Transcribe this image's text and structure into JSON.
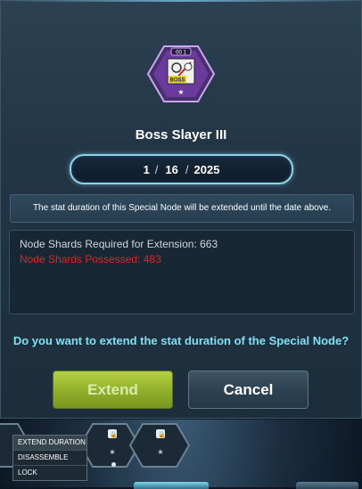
{
  "node": {
    "badge": "00 1",
    "icon_text": "BOSS",
    "name": "Boss Slayer III"
  },
  "date": {
    "month": "1",
    "day": "16",
    "year": "2025",
    "separator": "/"
  },
  "info_text": "The stat duration of this Special Node will be extended until the date above.",
  "shards": {
    "required_label": "Node Shards Required for Extension: 663",
    "possessed_label": "Node Shards Possessed: 483",
    "required_value": 663,
    "possessed_value": 483,
    "possessed_color": "#e02525"
  },
  "question": "Do you want to extend the stat duration of the Special Node?",
  "buttons": {
    "extend_label": "Extend",
    "cancel_label": "Cancel"
  },
  "context_menu": {
    "items": [
      "EXTEND DURATION",
      "DISASSEMBLE",
      "LOCK"
    ]
  },
  "colors": {
    "accent_cyan": "#7fe0f4",
    "extend_green": "#93b22c",
    "node_purple": "#6a3a9c"
  }
}
